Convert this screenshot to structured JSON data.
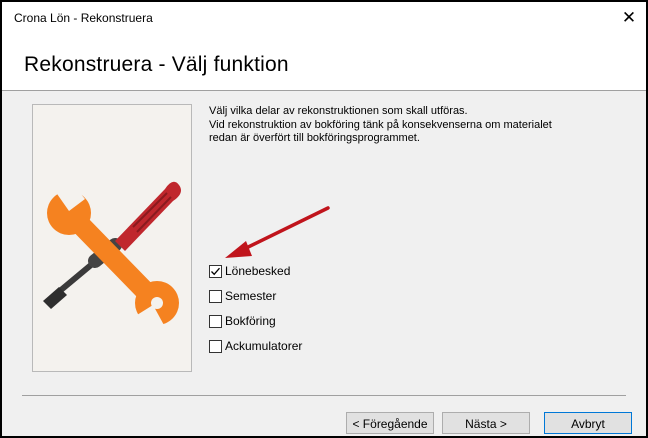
{
  "window": {
    "title": "Crona Lön - Rekonstruera",
    "close_symbol": "✕"
  },
  "header": {
    "title": "Rekonstruera - Välj funktion"
  },
  "illustration": {
    "icon": "wrench-and-screwdriver",
    "handle_color": "#f58220",
    "screwdriver_color": "#c0272d"
  },
  "description": {
    "lines": [
      "Välj vilka delar av rekonstruktionen som skall utföras.",
      "Vid rekonstruktion av bokföring tänk på konsekvenserna om materialet",
      "redan är överfört till bokföringsprogrammet."
    ]
  },
  "options": [
    {
      "label": "Lönebesked",
      "checked": true
    },
    {
      "label": "Semester",
      "checked": false
    },
    {
      "label": "Bokföring",
      "checked": false
    },
    {
      "label": "Ackumulatorer",
      "checked": false
    }
  ],
  "annotation": {
    "arrow_color": "#c0141c"
  },
  "buttons": {
    "back": "< Föregående",
    "next": "Nästa >",
    "cancel": "Avbryt"
  }
}
